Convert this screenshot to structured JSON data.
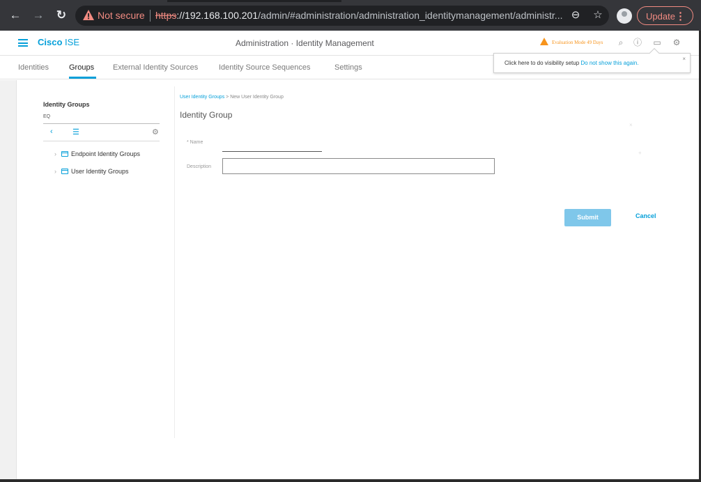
{
  "browser": {
    "security_label": "Not secure",
    "url_scheme": "https",
    "url_host": "://192.168.100.201",
    "url_path": "/admin/#administration/administration_identitymanagement/administr...",
    "update_label": "Update",
    "icons": [
      "back-arrow-icon",
      "forward-arrow-icon",
      "reload-icon",
      "warning-icon",
      "zoom-icon",
      "bookmark-star-icon",
      "profile-avatar-icon",
      "kebab-menu-icon"
    ]
  },
  "header": {
    "brand_bold": "Cisco",
    "brand_light": "ISE",
    "title": "Administration · Identity Management",
    "evaluation": "Evaluation Mode 49 Days"
  },
  "tabs": [
    {
      "label": "Identities"
    },
    {
      "label": "Groups"
    },
    {
      "label": "External Identity Sources"
    },
    {
      "label": "Identity Source Sequences"
    },
    {
      "label": "Settings"
    }
  ],
  "active_tab": "Groups",
  "tooltip": {
    "text": "Click here to do visibility setup",
    "link": "Do not show this again.",
    "close": "×"
  },
  "left_panel": {
    "title": "Identity Groups",
    "search_value": "EQ",
    "tree": [
      {
        "label": "Endpoint Identity Groups"
      },
      {
        "label": "User Identity Groups"
      }
    ]
  },
  "form": {
    "breadcrumb_link": "User Identity Groups",
    "breadcrumb_sep": ">",
    "breadcrumb_current": "New User Identity Group",
    "title": "Identity Group",
    "name_label": "* Name",
    "name_value": "",
    "description_label": "Description",
    "description_value": "",
    "submit_label": "Submit",
    "cancel_label": "Cancel"
  },
  "colors": {
    "accent": "#049fd9",
    "warning": "#f7941d",
    "submit_disabled": "#7fc7ea",
    "chrome": "#35363a"
  }
}
